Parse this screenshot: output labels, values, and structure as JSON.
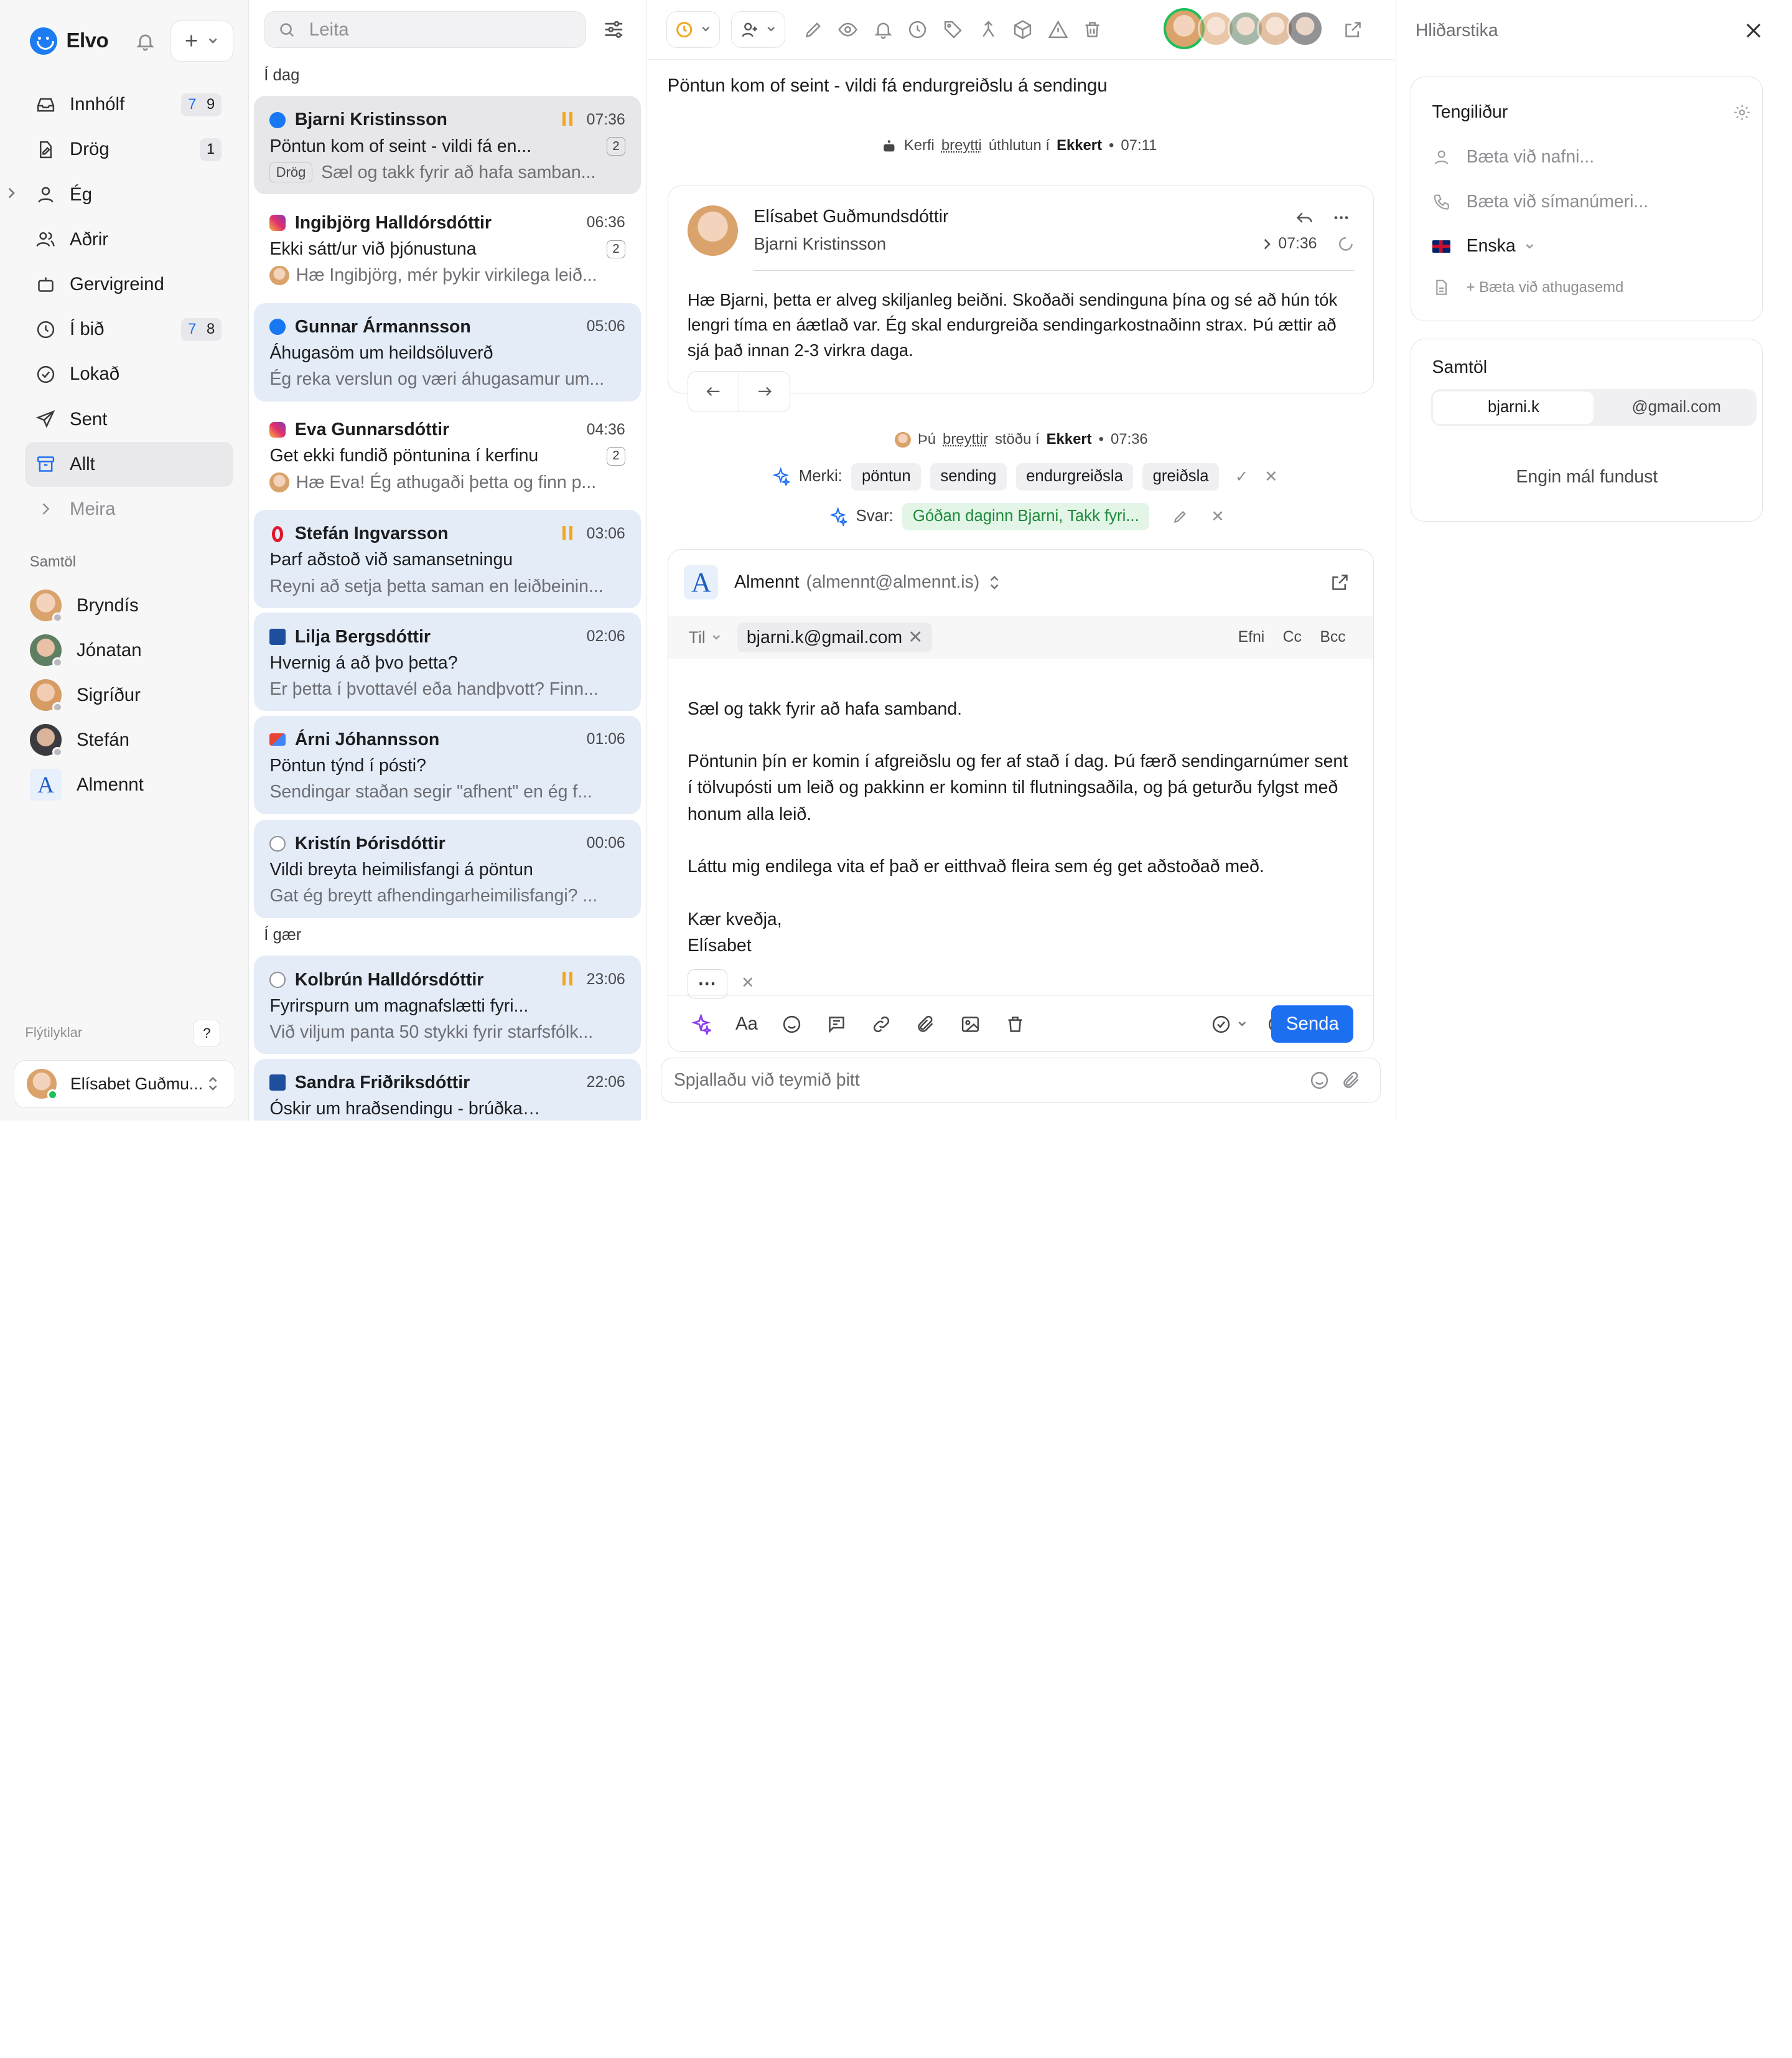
{
  "app": {
    "name": "Elvo"
  },
  "sidebar": {
    "items": [
      {
        "label": "Innhólf",
        "c1": "7",
        "c2": "9"
      },
      {
        "label": "Drög",
        "c1": "",
        "c2": "1"
      },
      {
        "label": "Ég"
      },
      {
        "label": "Aðrir"
      },
      {
        "label": "Gervigreind"
      },
      {
        "label": "Í bið",
        "c1": "7",
        "c2": "8"
      },
      {
        "label": "Lokað"
      },
      {
        "label": "Sent"
      },
      {
        "label": "Allt"
      },
      {
        "label": "Meira"
      }
    ],
    "section": "Samtöl",
    "conversations": [
      "Bryndís",
      "Jónatan",
      "Sigríður",
      "Stefán",
      "Almennt"
    ],
    "shortcuts": "Flýtilyklar",
    "shortcut_key": "?",
    "user": "Elísabet Guðmu..."
  },
  "list": {
    "search_placeholder": "Leita",
    "today": "Í dag",
    "yesterday": "Í gær",
    "items": [
      {
        "name": "Bjarni Kristinsson",
        "time": "07:36",
        "subject": "Pöntun kom of seint - vildi fá en...",
        "preview": "Sæl og takk fyrir að hafa samban...",
        "count": "2",
        "tag": "Drög",
        "channel": "facebook"
      },
      {
        "name": "Ingibjörg Halldórsdóttir",
        "time": "06:36",
        "subject": "Ekki sátt/ur við þjónustuna",
        "preview": "Hæ Ingibjörg, mér þykir virkilega leið...",
        "count": "2",
        "channel": "instagram"
      },
      {
        "name": "Gunnar Ármannsson",
        "time": "05:06",
        "subject": "Áhugasöm um heildsöluverð",
        "preview": "Ég reka verslun og væri áhugasamur um...",
        "channel": "facebook"
      },
      {
        "name": "Eva Gunnarsdóttir",
        "time": "04:36",
        "subject": "Get ekki fundið pöntunina í kerfinu",
        "preview": "Hæ Eva! Ég athugaði þetta og finn p...",
        "count": "2",
        "channel": "instagram"
      },
      {
        "name": "Stefán Ingvarsson",
        "time": "03:06",
        "subject": "Þarf aðstoð við samansetningu",
        "preview": "Reyni að setja þetta saman en leiðbeinin...",
        "channel": "opera"
      },
      {
        "name": "Lilja Bergsdóttir",
        "time": "02:06",
        "subject": "Hvernig á að þvo þetta?",
        "preview": "Er þetta í þvottavél eða handþvott? Finn...",
        "channel": "visir"
      },
      {
        "name": "Árni Jóhannsson",
        "time": "01:06",
        "subject": "Pöntun týnd í pósti?",
        "preview": "Sendingar staðan segir \"afhent\" en ég f...",
        "channel": "gmail"
      },
      {
        "name": "Kristín Þórisdóttir",
        "time": "00:06",
        "subject": "Vildi breyta heimilisfangi á pöntun",
        "preview": "Gat ég breytt afhendingarheimilisfangi? ...",
        "channel": "web"
      },
      {
        "name": "Kolbrún Halldórsdóttir",
        "time": "23:06",
        "subject": "Fyrirspurn um magnafslætti fyri...",
        "preview": "Við viljum panta 50 stykki fyrir starfsfólk...",
        "channel": "web"
      },
      {
        "name": "Sandra Friðriksdóttir",
        "time": "22:06",
        "subject": "Óskir um hraðsendingu - brúðkau...",
        "preview": "",
        "channel": "visir"
      }
    ]
  },
  "thread": {
    "subject": "Pöntun kom of seint - vildi fá endurgreiðslu á sendingu",
    "sys1": {
      "pre": "Kerfi",
      "verb": "breytti",
      "mid": "úthlutun í",
      "target": "Ekkert",
      "time": "07:11"
    },
    "message": {
      "author": "Elísabet Guðmundsdóttir",
      "to": "Bjarni Kristinsson",
      "time": "07:36",
      "body": "Hæ Bjarni, þetta er alveg skiljanleg beiðni. Skoðaði sendinguna þína og sé að hún tók lengri tíma en áætlað var. Ég skal endurgreiða sendingarkostnaðinn strax. Þú ættir að sjá það innan 2-3 virkra daga."
    },
    "sys2": {
      "pre": "Þú",
      "verb": "breyttir",
      "mid": "stöðu í",
      "target": "Ekkert",
      "time": "07:36"
    },
    "tags_label": "Merki:",
    "tags": [
      "pöntun",
      "sending",
      "endurgreiðsla",
      "greiðsla"
    ],
    "reply_label": "Svar:",
    "reply_suggestion": "Góðan daginn Bjarni, Takk fyri..."
  },
  "composer": {
    "from_name": "Almennt",
    "from_email": "(almennt@almennt.is)",
    "to_label": "Til",
    "recipient": "bjarni.k@gmail.com",
    "subject_btn": "Efni",
    "cc": "Cc",
    "bcc": "Bcc",
    "body": "Sæl og takk fyrir að hafa samband.\n\nPöntunin þín er komin í afgreiðslu og fer af stað í dag. Þú færð sendingarnúmer sent í tölvupósti um leið og pakkinn er kominn til flutningsaðila, og þá geturðu fylgst með honum alla leið.\n\nLáttu mig endilega vita ef það er eitthvað fleira sem ég get aðstoðað með.\n\nKær kveðja,\nElísabet",
    "font_label": "Aa",
    "send": "Senda",
    "chat_placeholder": "Spjallaðu við teymið þitt"
  },
  "right": {
    "title": "Hliðarstika",
    "contact": {
      "title": "Tengiliður",
      "name_placeholder": "Bæta við nafni...",
      "phone_placeholder": "Bæta við símanúmeri...",
      "language": "Enska",
      "note": "+ Bæta við athugasemd"
    },
    "convs": {
      "title": "Samtöl",
      "seg_user": "bjarni.k",
      "seg_domain": "@gmail.com",
      "empty": "Engin mál fundust"
    }
  },
  "colors": {
    "accent": "#1d6ff2",
    "unread_bg": "#e4ecf8",
    "online": "#1fbf5a",
    "pause": "#f3a51f"
  }
}
